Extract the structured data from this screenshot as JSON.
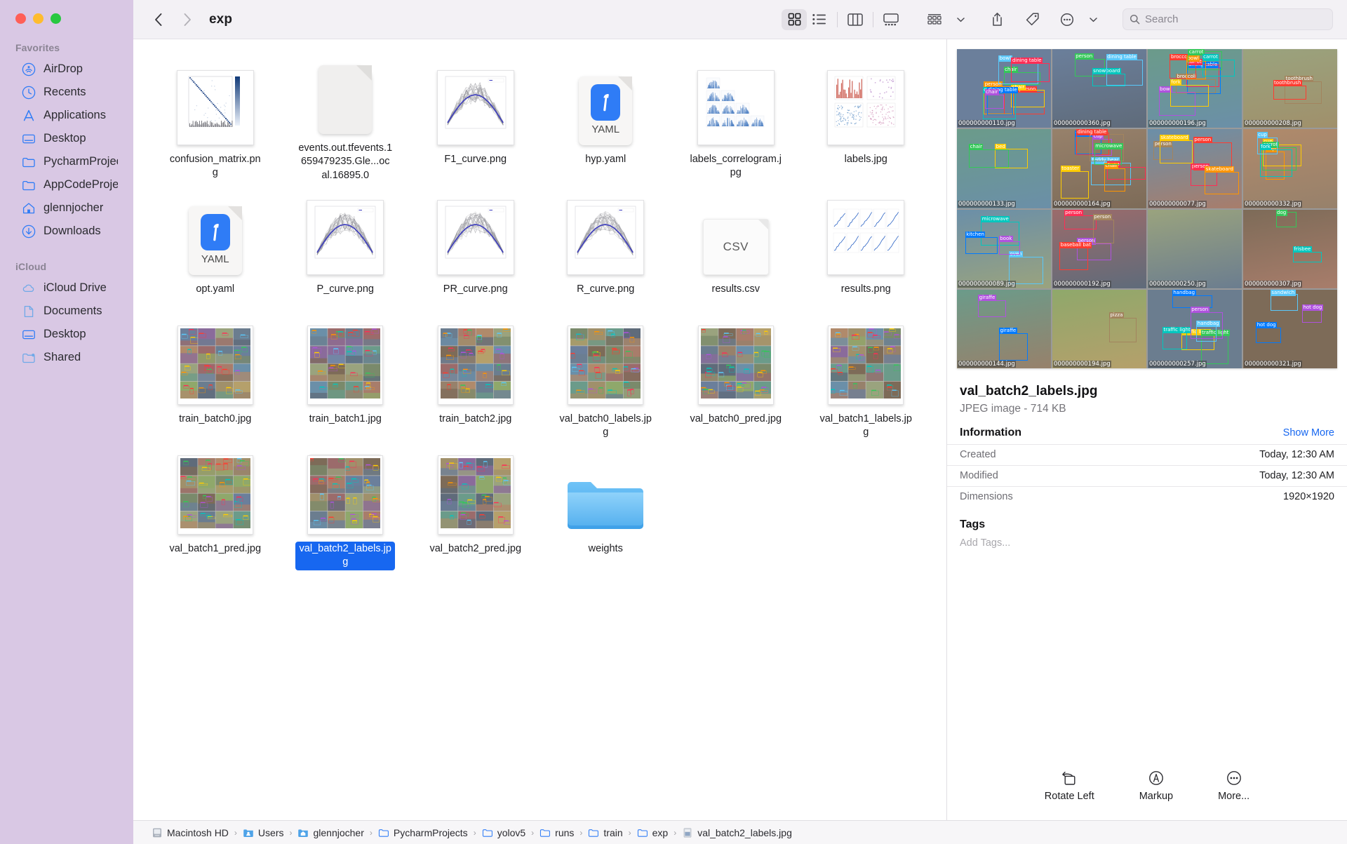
{
  "window": {
    "traffic_lights": [
      "close",
      "minimize",
      "zoom"
    ],
    "colors": {
      "accent": "#1767f0",
      "sidebar_bg": "#d9c8e4",
      "toolbar_bg": "#f3f1f5",
      "selection": "#1767f0"
    }
  },
  "sidebar": {
    "sections": [
      {
        "header": "Favorites",
        "items": [
          {
            "label": "AirDrop",
            "icon": "airdrop-icon"
          },
          {
            "label": "Recents",
            "icon": "clock-icon"
          },
          {
            "label": "Applications",
            "icon": "applications-icon"
          },
          {
            "label": "Desktop",
            "icon": "desktop-icon"
          },
          {
            "label": "PycharmProjects",
            "icon": "folder-icon"
          },
          {
            "label": "AppCodeProjects",
            "icon": "folder-icon"
          },
          {
            "label": "glennjocher",
            "icon": "home-icon"
          },
          {
            "label": "Downloads",
            "icon": "download-icon"
          }
        ]
      },
      {
        "header": "iCloud",
        "items": [
          {
            "label": "iCloud Drive",
            "icon": "cloud-icon"
          },
          {
            "label": "Documents",
            "icon": "document-icon"
          },
          {
            "label": "Desktop",
            "icon": "desktop-icon"
          },
          {
            "label": "Shared",
            "icon": "shared-folder-icon"
          }
        ]
      }
    ]
  },
  "toolbar": {
    "back_icon": "chevron-left-icon",
    "forward_icon": "chevron-right-icon",
    "title": "exp",
    "views": [
      {
        "name": "icon-view",
        "icon": "grid-icon",
        "active": true
      },
      {
        "name": "list-view",
        "icon": "list-icon",
        "active": false
      },
      {
        "name": "column-view",
        "icon": "columns-icon",
        "active": false
      },
      {
        "name": "gallery-view",
        "icon": "gallery-icon",
        "active": false
      }
    ],
    "group_icon": "group-by-icon",
    "share_icon": "share-icon",
    "tag_icon": "tag-icon",
    "more_icon": "ellipsis-icon",
    "search": {
      "placeholder": "Search",
      "value": "",
      "icon": "search-icon"
    }
  },
  "files": [
    {
      "name": "confusion_matrix.png",
      "kind": "image-confusion",
      "selected": false
    },
    {
      "name": "events.out.tfevents.1659479235.Gle...ocal.16895.0",
      "kind": "blank-doc",
      "selected": false
    },
    {
      "name": "F1_curve.png",
      "kind": "image-curve",
      "selected": false
    },
    {
      "name": "hyp.yaml",
      "kind": "yaml",
      "selected": false
    },
    {
      "name": "labels_correlogram.jpg",
      "kind": "image-correlogram",
      "selected": false
    },
    {
      "name": "labels.jpg",
      "kind": "image-labels",
      "selected": false
    },
    {
      "name": "opt.yaml",
      "kind": "yaml",
      "selected": false
    },
    {
      "name": "P_curve.png",
      "kind": "image-curve",
      "selected": false
    },
    {
      "name": "PR_curve.png",
      "kind": "image-curve",
      "selected": false
    },
    {
      "name": "R_curve.png",
      "kind": "image-curve",
      "selected": false
    },
    {
      "name": "results.csv",
      "kind": "csv",
      "selected": false
    },
    {
      "name": "results.png",
      "kind": "image-results",
      "selected": false
    },
    {
      "name": "train_batch0.jpg",
      "kind": "mosaic",
      "selected": false
    },
    {
      "name": "train_batch1.jpg",
      "kind": "mosaic",
      "selected": false
    },
    {
      "name": "train_batch2.jpg",
      "kind": "mosaic",
      "selected": false
    },
    {
      "name": "val_batch0_labels.jpg",
      "kind": "mosaic",
      "selected": false
    },
    {
      "name": "val_batch0_pred.jpg",
      "kind": "mosaic",
      "selected": false
    },
    {
      "name": "val_batch1_labels.jpg",
      "kind": "mosaic",
      "selected": false
    },
    {
      "name": "val_batch1_pred.jpg",
      "kind": "mosaic",
      "selected": false
    },
    {
      "name": "val_batch2_labels.jpg",
      "kind": "mosaic",
      "selected": true
    },
    {
      "name": "val_batch2_pred.jpg",
      "kind": "mosaic",
      "selected": false
    },
    {
      "name": "weights",
      "kind": "folder",
      "selected": false
    }
  ],
  "preview": {
    "title": "val_batch2_labels.jpg",
    "subtitle": "JPEG image - 714 KB",
    "section_title": "Information",
    "show_more": "Show More",
    "info_rows": [
      {
        "key": "Created",
        "value": "Today, 12:30 AM"
      },
      {
        "key": "Modified",
        "value": "Today, 12:30 AM"
      },
      {
        "key": "Dimensions",
        "value": "1920×1920"
      }
    ],
    "tags_title": "Tags",
    "tags_placeholder": "Add Tags...",
    "actions": [
      {
        "label": "Rotate Left",
        "icon": "rotate-left-icon"
      },
      {
        "label": "Markup",
        "icon": "markup-icon"
      },
      {
        "label": "More...",
        "icon": "ellipsis-circle-icon"
      }
    ],
    "image_tiles": [
      {
        "caption": "000000000110.jpg",
        "labels": [
          "persoperson",
          "person",
          "chair",
          "chair",
          "cup",
          "bowl",
          "dining table",
          "chair",
          "dining table"
        ]
      },
      {
        "caption": "000000000360.jpg",
        "labels": [
          "person",
          "snowboard",
          "dining table"
        ]
      },
      {
        "caption": "000000000196.jpg",
        "labels": [
          "dining table",
          "bowl",
          "carrot",
          "broccoli",
          "broccoli",
          "bowl",
          "fork",
          "carrot",
          "carrot"
        ]
      },
      {
        "caption": "000000000208.jpg",
        "labels": [
          "toothbrush",
          "toothbrush"
        ]
      },
      {
        "caption": "000000000133.jpg",
        "labels": [
          "bed",
          "chair"
        ]
      },
      {
        "caption": "000000000164.jpg",
        "labels": [
          "teddy bear",
          "wine glass",
          "cup",
          "vase",
          "bottle",
          "dining table",
          "chair",
          "toaster",
          "microwave"
        ]
      },
      {
        "caption": "000000000077.jpg",
        "labels": [
          "person",
          "person",
          "person",
          "skateboard",
          "skateboard"
        ]
      },
      {
        "caption": "000000000332.jpg",
        "labels": [
          "cup",
          "cup",
          "carrot",
          "fork",
          "cup"
        ]
      },
      {
        "caption": "000000000089.jpg",
        "labels": [
          "microwave",
          "oven",
          "kitchen",
          "book"
        ]
      },
      {
        "caption": "000000000192.jpg",
        "labels": [
          "person",
          "person",
          "person",
          "baseball bat"
        ]
      },
      {
        "caption": "000000000250.jpg",
        "labels": []
      },
      {
        "caption": "000000000307.jpg",
        "labels": [
          "dog",
          "frisbee"
        ]
      },
      {
        "caption": "000000000144.jpg",
        "labels": [
          "giraffe",
          "giraffe"
        ]
      },
      {
        "caption": "000000000194.jpg",
        "labels": [
          "pizza"
        ]
      },
      {
        "caption": "000000000257.jpg",
        "labels": [
          "traffic light",
          "traffic light",
          "traffic light",
          "handbag",
          "handbag",
          "person"
        ]
      },
      {
        "caption": "000000000321.jpg",
        "labels": [
          "sandwich",
          "hot dog",
          "hot dog"
        ]
      }
    ]
  },
  "pathbar": {
    "crumbs": [
      {
        "label": "Macintosh HD",
        "icon": "drive-icon"
      },
      {
        "label": "Users",
        "icon": "users-folder-icon"
      },
      {
        "label": "glennjocher",
        "icon": "home-folder-icon"
      },
      {
        "label": "PycharmProjects",
        "icon": "folder-icon"
      },
      {
        "label": "yolov5",
        "icon": "folder-icon"
      },
      {
        "label": "runs",
        "icon": "folder-icon"
      },
      {
        "label": "train",
        "icon": "folder-icon"
      },
      {
        "label": "exp",
        "icon": "folder-icon"
      },
      {
        "label": "val_batch2_labels.jpg",
        "icon": "file-icon"
      }
    ]
  }
}
